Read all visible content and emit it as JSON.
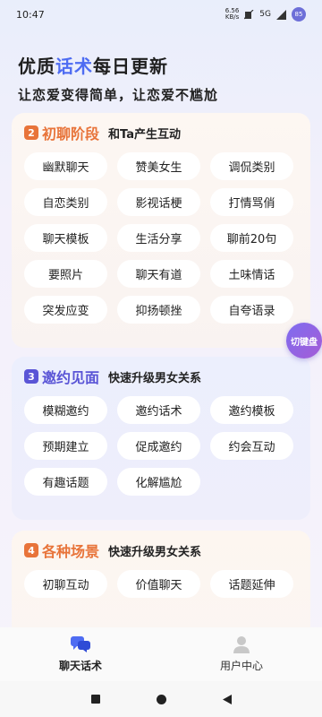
{
  "status": {
    "time": "10:47",
    "net_speed": "6.56",
    "net_unit": "KB/s",
    "signal": "5G",
    "battery": "85"
  },
  "hero": {
    "title_prefix": "优质",
    "title_accent": "话术",
    "title_suffix": "每日更新",
    "subtitle": "让恋爱变得简单，让恋爱不尴尬"
  },
  "sections": [
    {
      "number": "2",
      "title": "初聊阶段",
      "tagline": "和Ta产生互动",
      "accent": "#e8743a",
      "items": [
        "幽默聊天",
        "赞美女生",
        "调侃类别",
        "自恋类别",
        "影视话梗",
        "打情骂俏",
        "聊天模板",
        "生活分享",
        "聊前20句",
        "要照片",
        "聊天有道",
        "土味情话",
        "突发应变",
        "抑扬顿挫",
        "自夸语录"
      ]
    },
    {
      "number": "3",
      "title": "邀约见面",
      "tagline": "快速升级男女关系",
      "accent": "#5a55d6",
      "items": [
        "模糊邀约",
        "邀约话术",
        "邀约模板",
        "预期建立",
        "促成邀约",
        "约会互动",
        "有趣话题",
        "化解尴尬"
      ]
    },
    {
      "number": "4",
      "title": "各种场景",
      "tagline": "快速升级男女关系",
      "accent": "#e8743a",
      "items": [
        "初聊互动",
        "价值聊天",
        "话题延伸"
      ]
    }
  ],
  "float_button": {
    "label": "切键盘"
  },
  "tabbar": {
    "tab1": "聊天话术",
    "tab2": "用户中心"
  },
  "colors": {
    "accent_blue": "#4e6cf2",
    "orange": "#e8743a",
    "purple": "#5a55d6"
  }
}
